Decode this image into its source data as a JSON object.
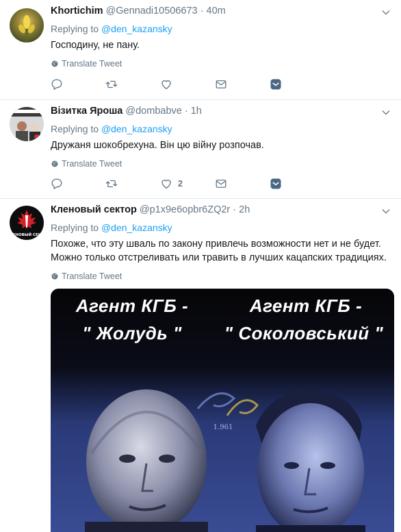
{
  "tweets": [
    {
      "name": "Khortichim",
      "handle": "@Gennadi10506673",
      "time": "40m",
      "replying_prefix": "Replying to",
      "replying_to": "@den_kazansky",
      "lines": [
        "Господину, не пану."
      ],
      "translate": "Translate Tweet",
      "likes": ""
    },
    {
      "name": "Візитка Яроша",
      "handle": "@dombabve",
      "time": "1h",
      "replying_prefix": "Replying to",
      "replying_to": "@den_kazansky",
      "lines": [
        "Дружаня шокобрехуна. Він цю війну розпочав."
      ],
      "translate": "Translate Tweet",
      "likes": "2"
    },
    {
      "name": "Кленовый сектор",
      "handle": "@p1x9e6opbr6ZQ2r",
      "time": "2h",
      "replying_prefix": "Replying to",
      "replying_to": "@den_kazansky",
      "lines": [
        "Похоже, что эту шваль по закону привлечь возможности нет и не будет.",
        "Можно только отстреливать или травить в лучших кацапских традициях."
      ],
      "translate": "Translate Tweet",
      "likes": ""
    }
  ],
  "avatar3_text": "ЛЕНОВЫЙ СЕКТ",
  "media": {
    "caption_left_1": "Агент КГБ -",
    "caption_left_2": "\" Жолудь \"",
    "caption_right_1": "Агент КГБ -",
    "caption_right_2": "\" Соколовський \"",
    "watermark_year": "1.961"
  },
  "colors": {
    "accent": "#1da1f2",
    "muted": "#657786",
    "divider": "#e6ecf0",
    "bookmark": "#4a6785"
  },
  "icons": [
    "chevron-down-icon",
    "globe-icon",
    "reply-icon",
    "retweet-icon",
    "heart-icon",
    "dm-envelope-icon",
    "bookmark-icon"
  ]
}
